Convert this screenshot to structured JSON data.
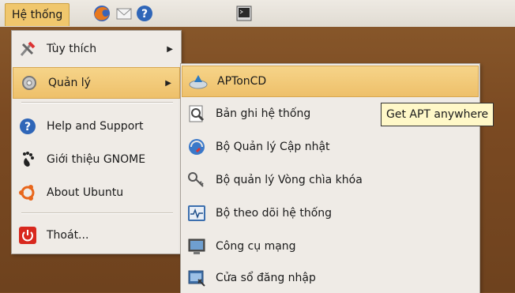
{
  "panel": {
    "system_menu": "Hệ thống",
    "icons": [
      "firefox-icon",
      "mail-icon",
      "help-icon",
      "terminal-icon"
    ]
  },
  "system_menu": {
    "items": [
      {
        "label": "Tùy thích",
        "icon": "preferences-icon",
        "submenu": true
      },
      {
        "label": "Quản lý",
        "icon": "administration-icon",
        "submenu": true
      },
      {
        "label": "Help and Support",
        "icon": "help-icon",
        "submenu": false
      },
      {
        "label": "Giới thiệu GNOME",
        "icon": "gnome-foot-icon",
        "submenu": false
      },
      {
        "label": "About Ubuntu",
        "icon": "ubuntu-icon",
        "submenu": false
      },
      {
        "label": "Thoát...",
        "icon": "shutdown-icon",
        "submenu": false
      }
    ]
  },
  "admin_menu": {
    "items": [
      {
        "label": "APTonCD",
        "icon": "aptoncd-icon"
      },
      {
        "label": "Bản ghi hệ thống",
        "icon": "system-log-icon"
      },
      {
        "label": "Bộ Quản lý Cập nhật",
        "icon": "update-manager-icon"
      },
      {
        "label": "Bộ quản lý Vòng chìa khóa",
        "icon": "keyring-icon"
      },
      {
        "label": "Bộ theo dõi hệ thống",
        "icon": "system-monitor-icon"
      },
      {
        "label": "Công cụ mạng",
        "icon": "network-tools-icon"
      },
      {
        "label": "Cửa sổ đăng nhập",
        "icon": "login-window-icon"
      }
    ]
  },
  "tooltip": {
    "text": "Get APT anywhere"
  },
  "colors": {
    "highlight": "#eec06a",
    "menu_bg": "#efebe6",
    "tooltip_bg": "#fff8c8"
  }
}
